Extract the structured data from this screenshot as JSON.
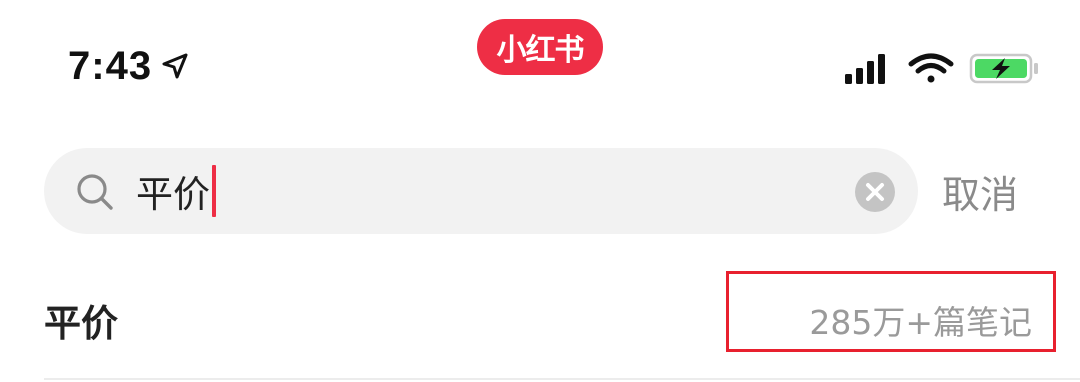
{
  "status_bar": {
    "time": "7:43",
    "location_icon": "location-arrow-icon",
    "signal_icon": "cellular-signal-icon",
    "wifi_icon": "wifi-icon",
    "battery_icon": "battery-charging-icon",
    "battery_color": "#4cd964"
  },
  "app_badge": {
    "label": "小红书",
    "color": "#ee2e45"
  },
  "search": {
    "value": "平价",
    "search_icon": "search-icon",
    "clear_icon": "clear-icon",
    "cancel_label": "取消"
  },
  "suggestions": [
    {
      "label": "平价",
      "count": "285万+篇笔记"
    }
  ],
  "annotation": {
    "color": "#e8202e"
  }
}
